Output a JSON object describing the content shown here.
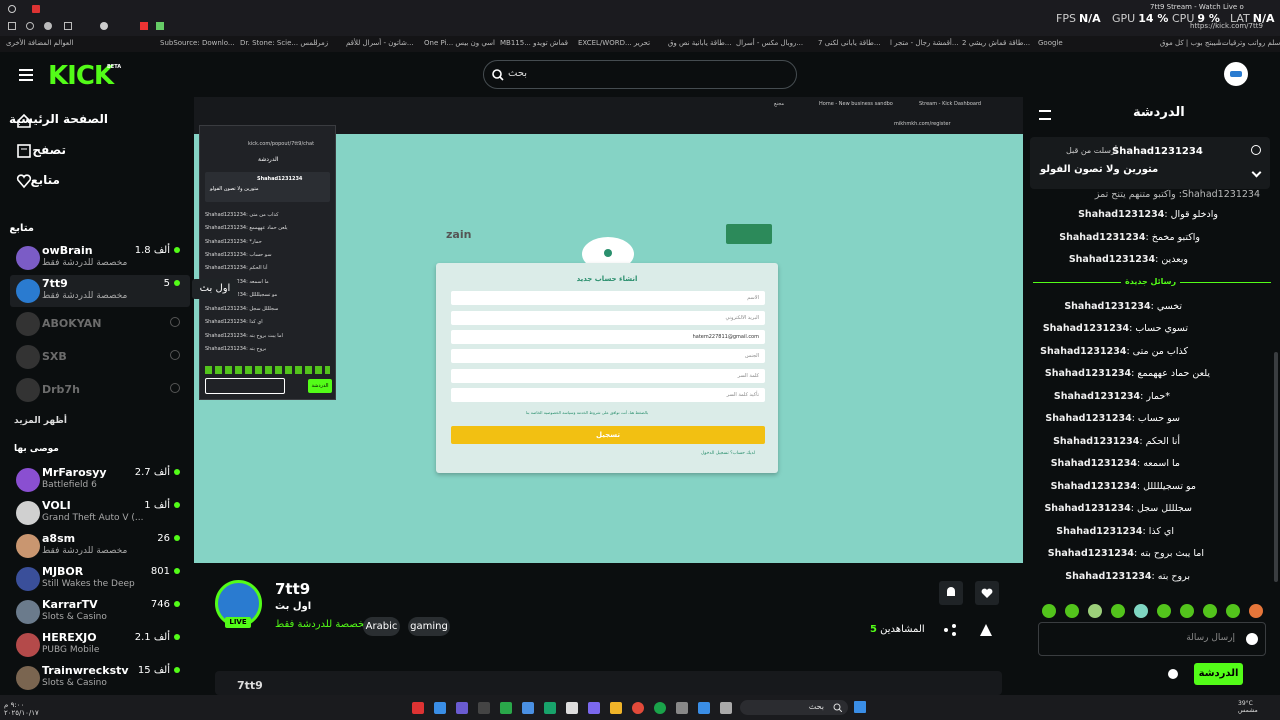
{
  "browser": {
    "tab_title": "7tt9 Stream - Watch Live o",
    "url": "https://kick.com/7tt9",
    "hud": {
      "fps_label": "FPS",
      "fps": "N/A",
      "gpu_label": "GPU",
      "gpu": "14 %",
      "cpu_label": "CPU",
      "cpu": "9 %",
      "lat_label": "LAT",
      "lat": "N/A"
    },
    "bookmarks": [
      "سلم رواتب وترقيات ا...",
      "سيبتج بوب | كل موق...",
      "Google",
      "طاقة قماش ريشي 2...",
      "أقمشة رجال - متجر ا...",
      "طاقة يابانى لكنى 7...",
      "روبال مكس - أسرال...",
      "طاقة يابانية نص وق...",
      "EXCEL/WORD... تحرير",
      "MB115... قماش تويدو",
      "One Pi... اسي ون بيس",
      "شاتون - أسرال للأقم...",
      "زمرد",
      "Dr. Stone: Scie... المس",
      "SubSource: Downlo..."
    ],
    "all_bookmarks": "العوالم المضافة الأخرى"
  },
  "header": {
    "logo": "KICK",
    "logo_beta": "BETA",
    "search_placeholder": "بحث"
  },
  "sidebar": {
    "nav": [
      {
        "label": "الصفحة الرئيسية",
        "icon": "home-icon"
      },
      {
        "label": "تصفح",
        "icon": "browse-icon"
      },
      {
        "label": "متابع",
        "icon": "heart-icon"
      }
    ],
    "following_title": "متابع",
    "following": [
      {
        "name": "owBrain",
        "sub": "مخصصة للدردشة فقط",
        "viewers": "1.8 ألف",
        "live": true,
        "color": "#7b5cc6"
      },
      {
        "name": "7tt9",
        "sub": "مخصصة للدردشة فقط",
        "viewers": "5",
        "live": true,
        "color": "#2a7bd0"
      },
      {
        "name": "ABOKYAN",
        "sub": "",
        "viewers": "",
        "live": false,
        "color": "#3a3a3a"
      },
      {
        "name": "SXB",
        "sub": "",
        "viewers": "",
        "live": false,
        "color": "#3a3a3a"
      },
      {
        "name": "Drb7h",
        "sub": "",
        "viewers": "",
        "live": false,
        "color": "#3a3a3a"
      }
    ],
    "tooltip": "اول بث",
    "show_more": "أظهر المزيد",
    "recommended_title": "موصى بها",
    "recommended": [
      {
        "name": "MrFarosyy",
        "sub": "Battlefield 6",
        "viewers": "2.7 ألف",
        "color": "#8a4fd1"
      },
      {
        "name": "VOLI",
        "sub": "Grand Theft Auto V (...",
        "viewers": "1 ألف",
        "color": "#d0d0d0"
      },
      {
        "name": "a8sm",
        "sub": "مخصصة للدردشة فقط",
        "viewers": "26",
        "color": "#c99670"
      },
      {
        "name": "MJBOR",
        "sub": "Still Wakes the Deep",
        "viewers": "801",
        "color": "#3a4f9a"
      },
      {
        "name": "KarrarTV",
        "sub": "Slots & Casino",
        "viewers": "746",
        "color": "#6b7b8c"
      },
      {
        "name": "HEREXJO",
        "sub": "PUBG Mobile",
        "viewers": "2.1 ألف",
        "color": "#b44a4a"
      },
      {
        "name": "Trainwreckstv",
        "sub": "Slots & Casino",
        "viewers": "15 ألف",
        "color": "#7a6550"
      }
    ]
  },
  "video": {
    "inner_tabs": [
      "Home - New business sandbo",
      "Stream - Kick Dashboard",
      "مجنع"
    ],
    "inner_url": "mikhmkh.com/register",
    "popup": {
      "url": "kick.com/popout/7tt9/chat",
      "title": "الدردشة",
      "pinned_user": "Shahad1231234",
      "pinned_text": "متورين ولا تصون الفولو",
      "messages": [
        "Shahad1231234: كذاب من متى",
        "Shahad1231234: يلعن حماد عههممع",
        "Shahad1231234: *حمار",
        "Shahad1231234: سو حساب",
        "Shahad1231234: أنا الحكم",
        "Shahad1231234: ما اسمعه",
        "Shahad1231234: مو تسجيللللل",
        "Shahad1231234: سجلللل سجل",
        "Shahad1231234: اي كذا",
        "Shahad1231234: اما يبث بروح بته",
        "Shahad1231234: بروح بته"
      ],
      "send": "الدردشة"
    },
    "zain": "zain",
    "form": {
      "title": "انشاء حساب جديد",
      "fields": [
        "الاسم",
        "البريد الالكتروني",
        "hatem227811@gmail.com",
        "الجنس",
        "كلمة السر",
        "تأكيد كلمة السر"
      ],
      "terms": "بالضغط هنا، أنت توافق على شروط الخدمة وسياسة الخصوصية الخاصة بنا",
      "submit": "تسجيل",
      "login": "لديك حساب؟ تسجيل الدخول"
    }
  },
  "stream": {
    "name": "7tt9",
    "title": "اول بث",
    "category": "مخصصة للدردشة فقط",
    "live_badge": "LIVE",
    "tags": [
      "Arabic",
      "gaming"
    ],
    "viewers_label": "المشاهدين",
    "viewers": "5",
    "footer_name": "7tt9"
  },
  "chat": {
    "title": "الدردشة",
    "pinned": {
      "user": "Shahad1231234",
      "meta": "أرسلت من قبل",
      "text": "متورين ولا تصون الفولو"
    },
    "partial": "Shahad1231234: واكتبو متنهم يتنح تمز",
    "messages_before": [
      {
        "user": "Shahad1231234",
        "text": "وادخلو قوال"
      },
      {
        "user": "Shahad1231234",
        "text": "واكتبو مخمخ"
      },
      {
        "user": "Shahad1231234",
        "text": "وبعدين"
      }
    ],
    "new_messages_label": "رسائل جديدة",
    "messages_after": [
      {
        "user": "Shahad1231234",
        "text": "تخسي"
      },
      {
        "user": "Shahad1231234",
        "text": "تسوي حساب"
      },
      {
        "user": "Shahad1231234",
        "text": "كذاب من متى"
      },
      {
        "user": "Shahad1231234",
        "text": "يلعن حماد عههممع"
      },
      {
        "user": "Shahad1231234",
        "text": "*حمار"
      },
      {
        "user": "Shahad1231234",
        "text": "سو حساب"
      },
      {
        "user": "Shahad1231234",
        "text": "أنا الحكم"
      },
      {
        "user": "Shahad1231234",
        "text": "ما اسمعه"
      },
      {
        "user": "Shahad1231234",
        "text": "مو تسجيللللل"
      },
      {
        "user": "Shahad1231234",
        "text": "سجلللل سجل"
      },
      {
        "user": "Shahad1231234",
        "text": "اي كذا"
      },
      {
        "user": "Shahad1231234",
        "text": "اما يبث بروح بته"
      },
      {
        "user": "Shahad1231234",
        "text": "بروح بته"
      }
    ],
    "input_placeholder": "إرسال رسالة",
    "send_button": "الدردشة"
  },
  "taskbar": {
    "search": "بحث",
    "weather": "39°C",
    "weather_sub": "مشمس",
    "time": "٩:٠٠ م",
    "date": "٢٠٢٥/١٠/١٧"
  },
  "colors": {
    "accent": "#53fc18",
    "bg": "#0b0e0f",
    "video_bg": "#85d3c5",
    "form_button": "#f2c012"
  }
}
